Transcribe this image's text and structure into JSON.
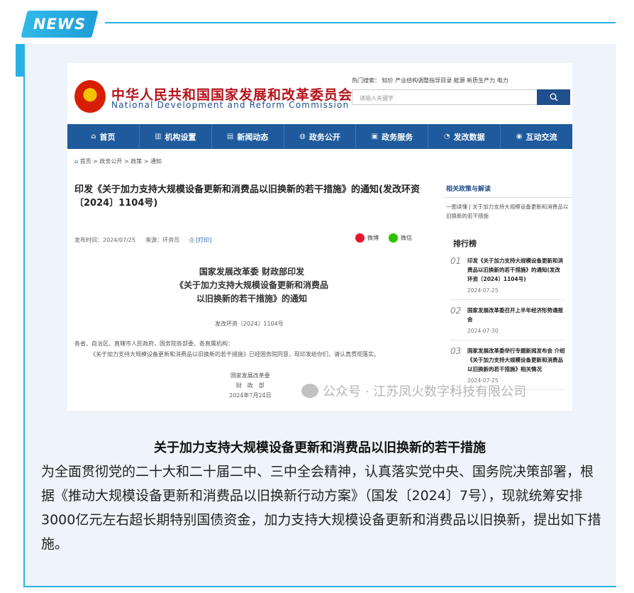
{
  "badge": "NEWS",
  "screenshot": {
    "org_cn": "中华人民共和国国家发展和改革委员会",
    "org_en": "National Development and Reform Commission",
    "hot_search": "热门搜索： 知价  产业结构调整指导目录  能源  新质生产力  电力",
    "search_placeholder": "请输入关键字",
    "nav": [
      {
        "label": "首页",
        "icon": "home-icon"
      },
      {
        "label": "机构设置",
        "icon": "building-icon"
      },
      {
        "label": "新闻动态",
        "icon": "news-icon"
      },
      {
        "label": "政务公开",
        "icon": "globe-icon"
      },
      {
        "label": "政务服务",
        "icon": "service-icon"
      },
      {
        "label": "发改数据",
        "icon": "chart-icon"
      },
      {
        "label": "互动交流",
        "icon": "chat-icon"
      }
    ],
    "breadcrumb": "首页 > 政务公开 > 政策 > 通知",
    "article_title": "印发《关于加力支持大规模设备更新和消费品以旧换新的若干措施》的通知(发改环资〔2024〕1104号)",
    "publish_time": "发布时间：2024/07/25",
    "source": "来源：环资司",
    "print": "[打印]",
    "share_weibo": "微博",
    "share_wechat": "微信",
    "doc_title_1": "国家发展改革委 财政部印发",
    "doc_title_2": "《关于加力支持大规模设备更新和消费品",
    "doc_title_3": "以旧换新的若干措施》的通知",
    "doc_no": "发改环资〔2024〕1104号",
    "addressee": "各省、自治区、直辖市人民政府，国务院各部委、各直属机构：",
    "body_line": "《关于加力支持大规模设备更新和消费品以旧换新的若干措施》已经国务院同意，现印发给你们，请认真贯彻落实。",
    "sign_1": "国家发展改革委",
    "sign_2": "财　政　部",
    "sign_3": "2024年7月24日",
    "related_heading": "相关政策与解读",
    "related_link": "一图读懂 | 关于加力支持大规模设备更新和消费品以旧换新的若干措施",
    "rank_heading": "排行榜",
    "rank": [
      {
        "num": "01",
        "title": "印发《关于加力支持大规模设备更新和消费品以旧换新的若干措施》的通知(发改环资〔2024〕1104号)",
        "date": "2024-07-25"
      },
      {
        "num": "02",
        "title": "国家发展改革委召开上半年经济形势通报会",
        "date": "2024-07-30"
      },
      {
        "num": "03",
        "title": "国家发展改革委举行专题新闻发布会 介绍《关于加力支持大规模设备更新和消费品以旧换新的若干措施》相关情况",
        "date": "2024-07-25"
      }
    ],
    "watermark": "公众号 · 江苏凤火数字科技有限公司"
  },
  "caption": "关于加力支持大规模设备更新和消费品以旧换新的若干措施",
  "paragraph": "为全面贯彻党的二十大和二十届二中、三中全会精神，认真落实党中央、国务院决策部署，根据《推动大规模设备更新和消费品以旧换新行动方案》（国发〔2024〕7号），现就统筹安排3000亿元左右超长期特别国债资金，加力支持大规模设备更新和消费品以旧换新，提出如下措施。",
  "colors": {
    "accent": "#2ab0e4",
    "nav": "#1f5b9c",
    "title_red": "#b5121b"
  }
}
